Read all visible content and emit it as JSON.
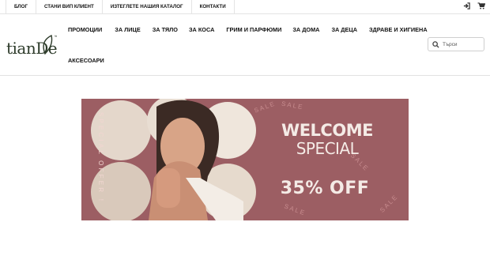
{
  "topbar": {
    "links": [
      "БЛОГ",
      "СТАНИ ВИП КЛИЕНТ",
      "ИЗТЕГЛЕТЕ НАШИЯ КАТАЛОГ",
      "КОНТАКТИ"
    ],
    "icons": [
      "login-icon",
      "cart-icon"
    ]
  },
  "header": {
    "logo_text": "tianDe",
    "logo_tm": "™",
    "menu": [
      "ПРОМОЦИИ",
      "ЗА ЛИЦЕ",
      "ЗА ТЯЛО",
      "ЗА КОСА",
      "ГРИМ И ПАРФЮМИ",
      "ЗА ДОМА",
      "ЗА ДЕЦА",
      "ЗДРАВЕ И ХИГИЕНА",
      "АКСЕСОАРИ"
    ],
    "search_placeholder": "Търси"
  },
  "banner": {
    "side_text": "SPECIAL OFFER !",
    "arc_text": "SALE",
    "title_line1": "WELCOME",
    "title_line2": "SPECIAL",
    "offer": "35% OFF",
    "colors": {
      "background": "#9c5e63",
      "text": "#f4ebe6",
      "side_text": "#f1d6d1"
    }
  }
}
